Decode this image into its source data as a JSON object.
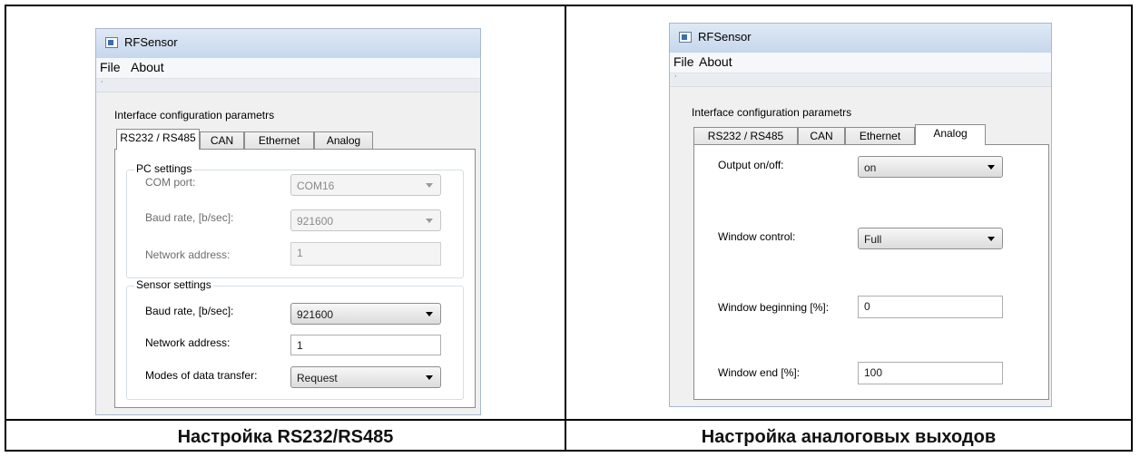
{
  "captions": {
    "left": "Настройка RS232/RS485",
    "right": "Настройка аналоговых выходов"
  },
  "left_window": {
    "title": "RFSensor",
    "menu": [
      "File",
      "About"
    ],
    "group_title": "Interface configuration parametrs",
    "tabs": [
      "RS232 / RS485",
      "CAN",
      "Ethernet",
      "Analog"
    ],
    "active_tab": "RS232 / RS485",
    "pc_settings": {
      "legend": "PC settings",
      "com_port_label": "COM port:",
      "com_port_value": "COM16",
      "baud_label": "Baud rate, [b/sec]:",
      "baud_value": "921600",
      "address_label": "Network address:",
      "address_value": "1"
    },
    "sensor_settings": {
      "legend": "Sensor settings",
      "baud_label": "Baud rate, [b/sec]:",
      "baud_value": "921600",
      "address_label": "Network address:",
      "address_value": "1",
      "mode_label": "Modes of data transfer:",
      "mode_value": "Request"
    }
  },
  "right_window": {
    "title": "RFSensor",
    "menu": [
      "File",
      "About"
    ],
    "group_title": "Interface configuration parametrs",
    "tabs": [
      "RS232 / RS485",
      "CAN",
      "Ethernet",
      "Analog"
    ],
    "active_tab": "Analog",
    "output_label": "Output on/off:",
    "output_value": "on",
    "window_control_label": "Window control:",
    "window_control_value": "Full",
    "window_begin_label": "Window beginning [%]:",
    "window_begin_value": "0",
    "window_end_label": "Window end [%]:",
    "window_end_value": "100"
  }
}
